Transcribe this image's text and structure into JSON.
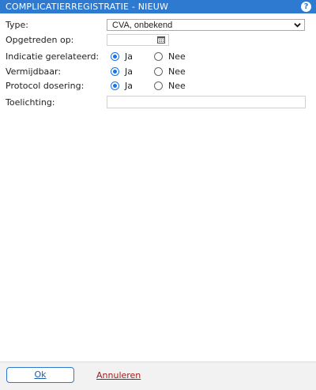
{
  "window": {
    "title": "COMPLICATIERREGISTRATIE - NIEUW",
    "help_glyph": "?"
  },
  "form": {
    "type_label": "Type:",
    "type_value": "CVA, onbekend",
    "date_label": "Opgetreden op:",
    "date_value": "",
    "indicatie_label": "Indicatie gerelateerd:",
    "vermijdbaar_label": "Vermijdbaar:",
    "protocol_label": "Protocol dosering:",
    "toelichting_label": "Toelichting:",
    "toelichting_value": "",
    "option_yes": "Ja",
    "option_no": "Nee",
    "selected": {
      "indicatie": "Ja",
      "vermijdbaar": "Ja",
      "protocol": "Ja"
    }
  },
  "footer": {
    "ok_label": "Ok",
    "cancel_label": "Annuleren"
  },
  "colors": {
    "titlebar": "#2e7ad1",
    "radio_selected": "#1a73e8",
    "cancel_link": "#9b1b1b"
  }
}
